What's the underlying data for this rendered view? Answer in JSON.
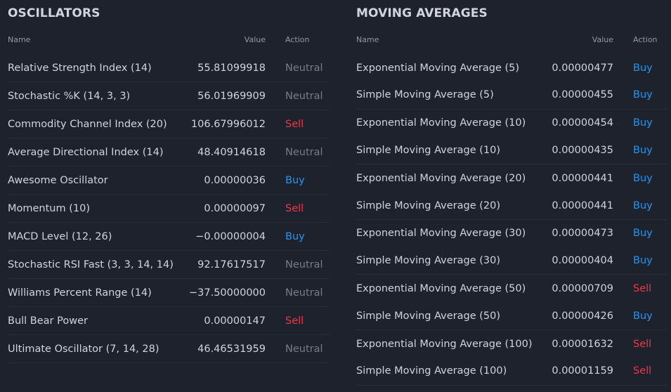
{
  "oscillators": {
    "title": "OSCILLATORS",
    "headers": {
      "name": "Name",
      "value": "Value",
      "action": "Action"
    },
    "rows": [
      {
        "name": "Relative Strength Index (14)",
        "value": "55.81099918",
        "action": "Neutral"
      },
      {
        "name": "Stochastic %K (14, 3, 3)",
        "value": "56.01969909",
        "action": "Neutral"
      },
      {
        "name": "Commodity Channel Index (20)",
        "value": "106.67996012",
        "action": "Sell"
      },
      {
        "name": "Average Directional Index (14)",
        "value": "48.40914618",
        "action": "Neutral"
      },
      {
        "name": "Awesome Oscillator",
        "value": "0.00000036",
        "action": "Buy"
      },
      {
        "name": "Momentum (10)",
        "value": "0.00000097",
        "action": "Sell"
      },
      {
        "name": "MACD Level (12, 26)",
        "value": "−0.00000004",
        "action": "Buy"
      },
      {
        "name": "Stochastic RSI Fast (3, 3, 14, 14)",
        "value": "92.17617517",
        "action": "Neutral"
      },
      {
        "name": "Williams Percent Range (14)",
        "value": "−37.50000000",
        "action": "Neutral"
      },
      {
        "name": "Bull Bear Power",
        "value": "0.00000147",
        "action": "Sell"
      },
      {
        "name": "Ultimate Oscillator (7, 14, 28)",
        "value": "46.46531959",
        "action": "Neutral"
      }
    ]
  },
  "moving_averages": {
    "title": "MOVING AVERAGES",
    "headers": {
      "name": "Name",
      "value": "Value",
      "action": "Action"
    },
    "rows": [
      {
        "name": "Exponential Moving Average (5)",
        "value": "0.00000477",
        "action": "Buy"
      },
      {
        "name": "Simple Moving Average (5)",
        "value": "0.00000455",
        "action": "Buy"
      },
      {
        "name": "Exponential Moving Average (10)",
        "value": "0.00000454",
        "action": "Buy"
      },
      {
        "name": "Simple Moving Average (10)",
        "value": "0.00000435",
        "action": "Buy"
      },
      {
        "name": "Exponential Moving Average (20)",
        "value": "0.00000441",
        "action": "Buy"
      },
      {
        "name": "Simple Moving Average (20)",
        "value": "0.00000441",
        "action": "Buy"
      },
      {
        "name": "Exponential Moving Average (30)",
        "value": "0.00000473",
        "action": "Buy"
      },
      {
        "name": "Simple Moving Average (30)",
        "value": "0.00000404",
        "action": "Buy"
      },
      {
        "name": "Exponential Moving Average (50)",
        "value": "0.00000709",
        "action": "Sell"
      },
      {
        "name": "Simple Moving Average (50)",
        "value": "0.00000426",
        "action": "Buy"
      },
      {
        "name": "Exponential Moving Average (100)",
        "value": "0.00001632",
        "action": "Sell"
      },
      {
        "name": "Simple Moving Average (100)",
        "value": "0.00001159",
        "action": "Sell"
      }
    ]
  },
  "colors": {
    "background": "#1e222d",
    "text": "#d1d4dc",
    "muted": "#9598a1",
    "neutral": "#787b86",
    "buy": "#2196f3",
    "sell": "#f23645",
    "divider": "#2a2e39"
  }
}
